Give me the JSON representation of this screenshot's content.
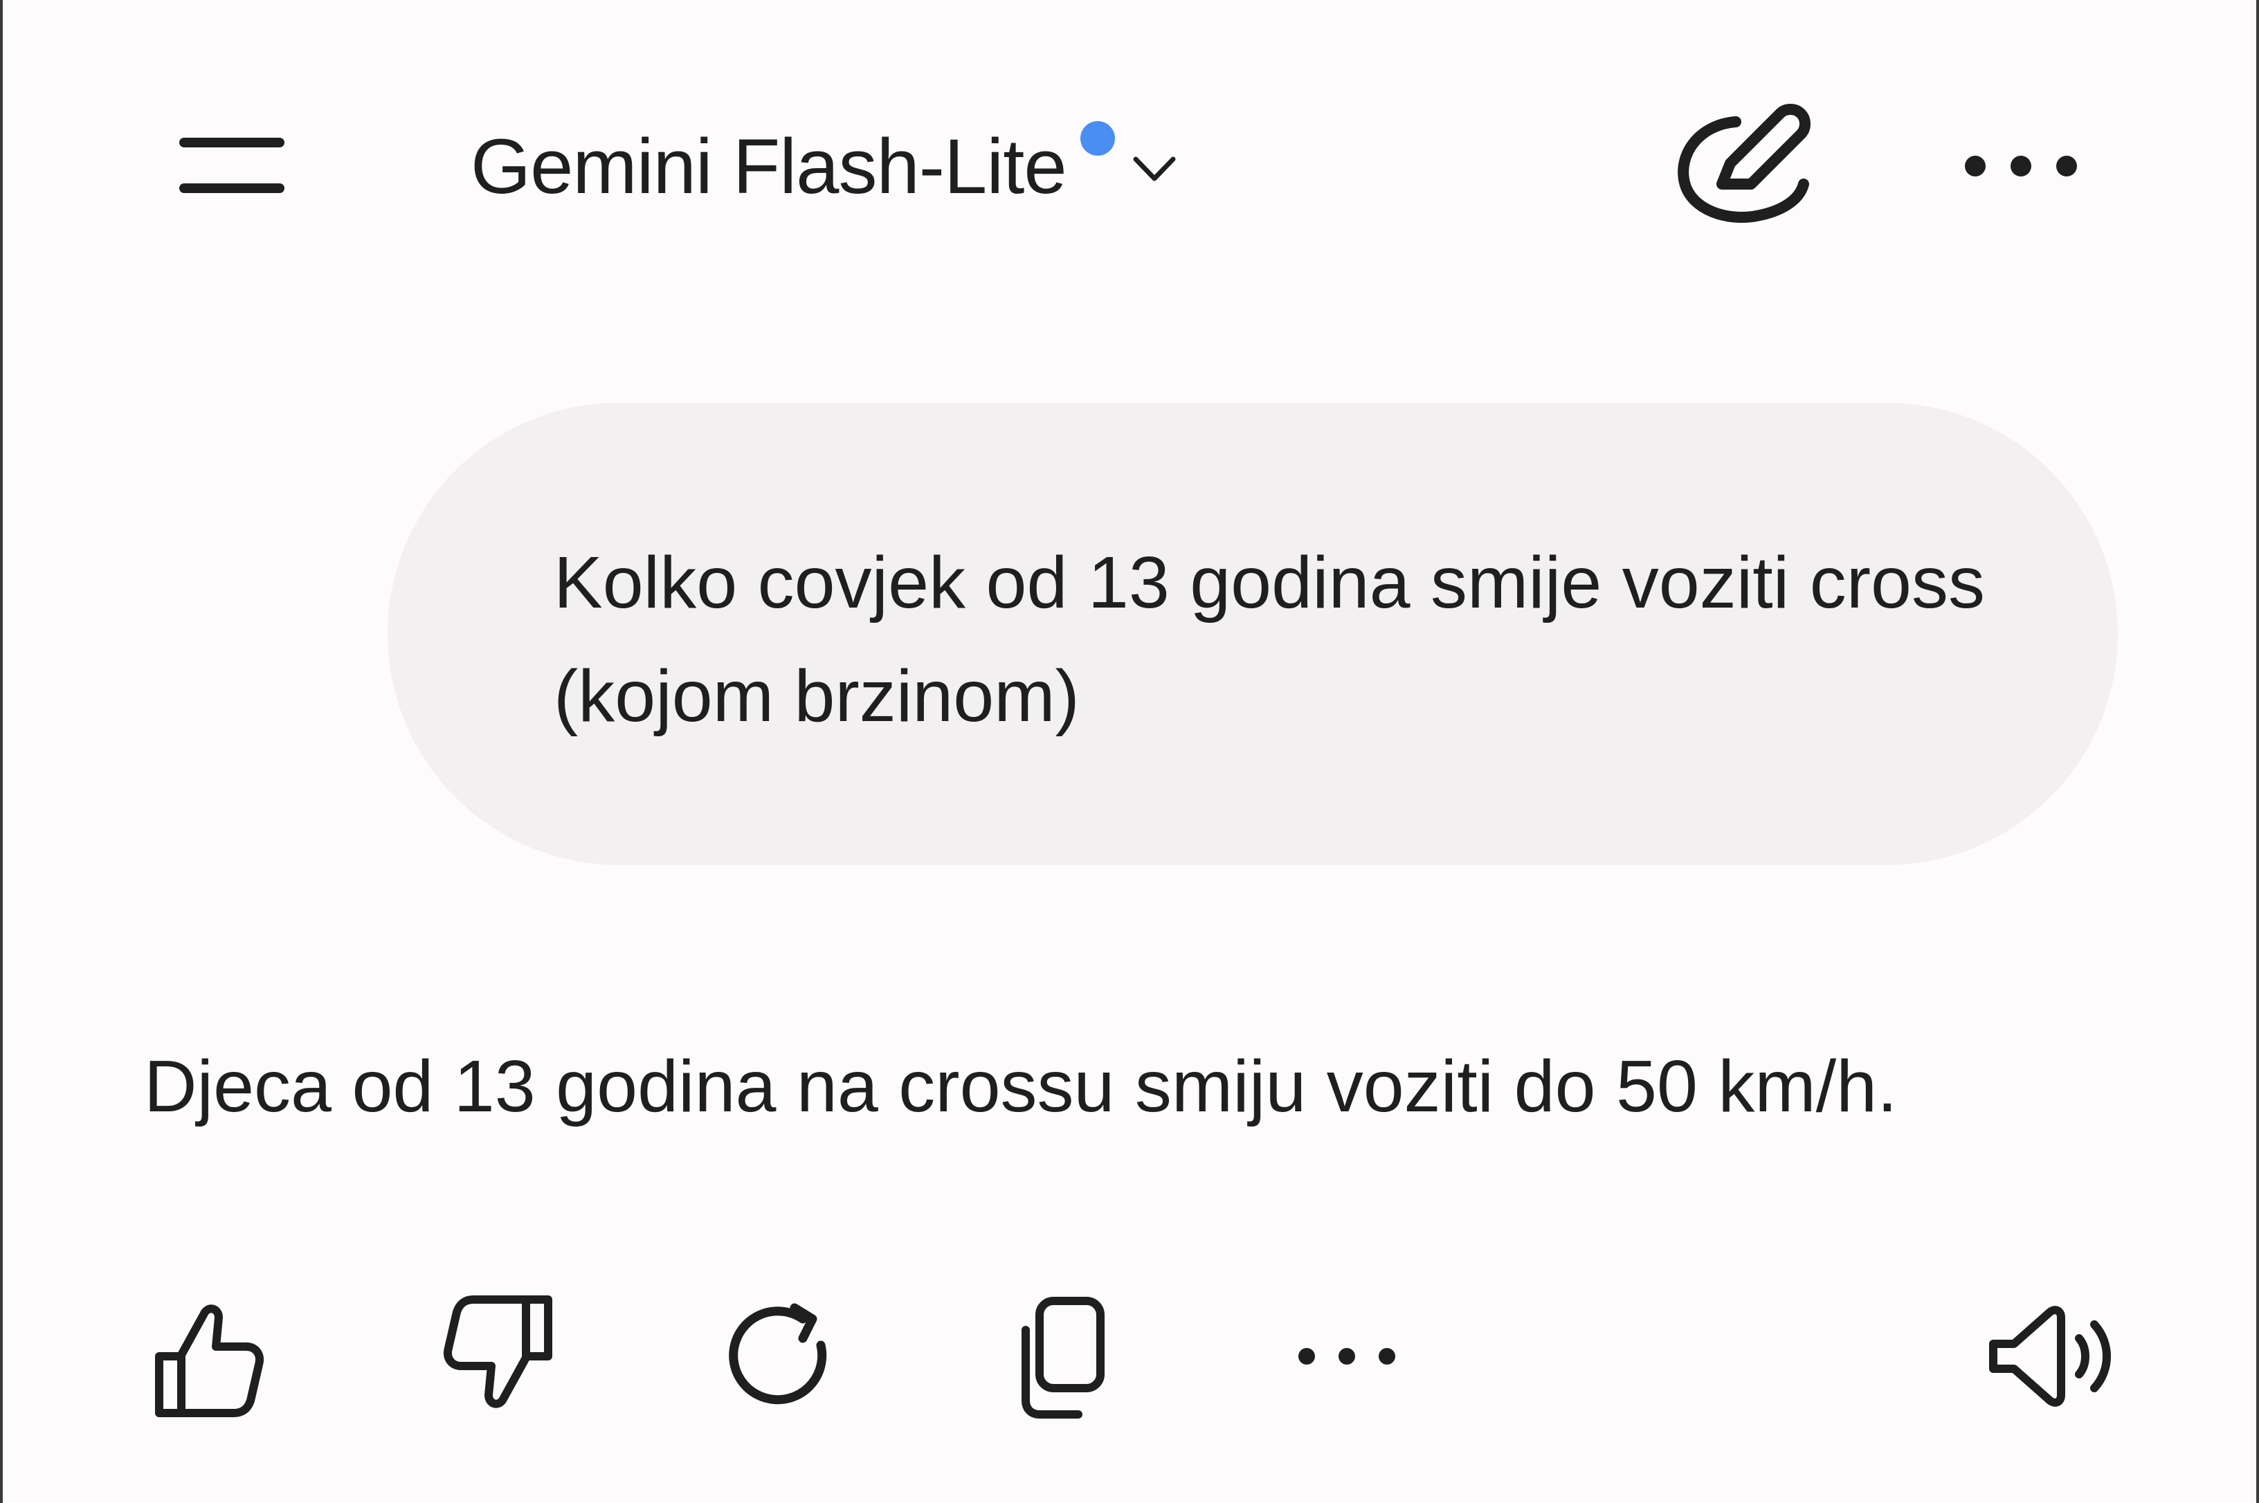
{
  "header": {
    "model_name": "Gemini Flash-Lite",
    "menu_icon": "hamburger-menu-icon",
    "new_indicator_color": "#4a8ef2",
    "dropdown_icon": "chevron-down-icon",
    "new_chat_icon": "pencil-edit-icon",
    "more_icon": "more-horizontal-icon"
  },
  "conversation": {
    "user_message": "Kolko covjek od 13 godina smije voziti cross (kojom brzinom)",
    "model_response": "Djeca od 13 godina na crossu smiju voziti do 50 km/h."
  },
  "response_actions": [
    {
      "icon": "thumbs-up-icon"
    },
    {
      "icon": "thumbs-down-icon"
    },
    {
      "icon": "regenerate-icon"
    },
    {
      "icon": "copy-icon"
    },
    {
      "icon": "more-horizontal-icon"
    },
    {
      "icon": "speaker-icon"
    }
  ],
  "colors": {
    "background": "#fdfbfb",
    "bubble": "#f2f0f0",
    "text": "#1f1f1f",
    "accent": "#4a8ef2"
  }
}
